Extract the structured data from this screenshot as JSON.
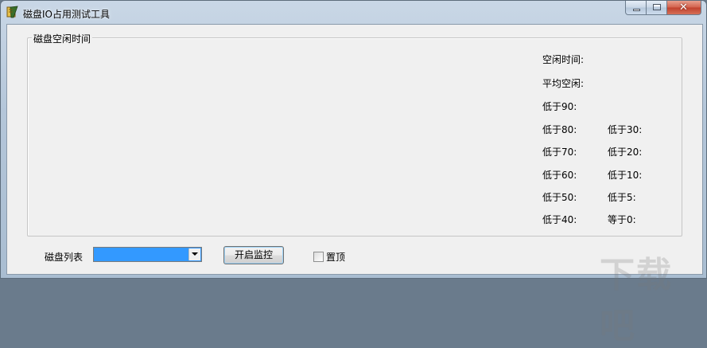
{
  "window": {
    "title": "磁盘IO占用测试工具",
    "icon": "app-icon",
    "close_glyph": "✕"
  },
  "group": {
    "title": "磁盘空闲时间"
  },
  "stats": {
    "idle_time": "空闲时间:",
    "avg_idle": "平均空闲:",
    "below90": "低于90:",
    "below80": "低于80:",
    "below70": "低于70:",
    "below60": "低于60:",
    "below50": "低于50:",
    "below40": "低于40:",
    "below30": "低于30:",
    "below20": "低于20:",
    "below10": "低于10:",
    "below5": "低于5:",
    "equal0": "等于0:"
  },
  "controls": {
    "disk_list_label": "磁盘列表",
    "disk_list_value": "",
    "start_button": "开启监控",
    "topmost_label": "置顶",
    "topmost_checked": false
  },
  "watermark": "下载吧"
}
